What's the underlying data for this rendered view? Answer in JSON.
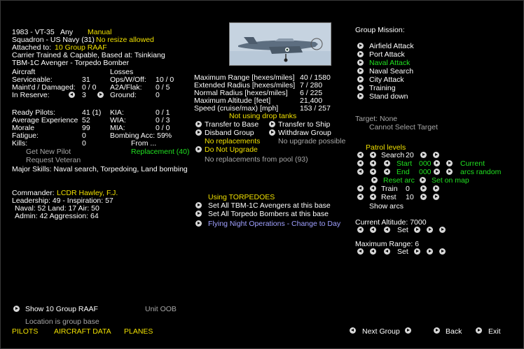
{
  "unit": {
    "line1_left": "1983 - VT-35",
    "line1_any": "Any",
    "line1_manual": "Manual",
    "squadron": "Squadron - US Navy (31)",
    "no_resize": "No resize allowed",
    "attached_label": "Attached to:",
    "attached_group": "10 Group RAAF",
    "carrier_info": "Carrier Trained & Capable, Based at:  Tsinkiang",
    "aircraft_type": "TBM-1C Avenger - Torpedo Bomber"
  },
  "aircraft_stats": {
    "header_aircraft": "Aircraft",
    "header_losses": "Losses",
    "serviceable_label": "Serviceable:",
    "serviceable_val": "31",
    "maint_label": "Maint'd / Damaged:",
    "maint_val": "0 / 0",
    "reserve_label": "In Reserve:",
    "reserve_val": "3",
    "opsoff_label": "Ops/W/Off:",
    "opsoff_val": "10 / 0",
    "a2a_label": "A2A/Flak:",
    "a2a_val": "0 / 5",
    "ground_label": "Ground:",
    "ground_val": "0"
  },
  "pilots": {
    "ready_label": "Ready Pilots:",
    "ready_val": "41 (1)",
    "exp_label": "Average Experience",
    "exp_val": "52",
    "morale_label": "Morale",
    "morale_val": "99",
    "fatigue_label": "Fatigue:",
    "fatigue_val": "0",
    "kills_label": "Kills:",
    "kills_val": "0",
    "kia_label": "KIA:",
    "kia_val": "0 / 1",
    "wia_label": "WIA:",
    "wia_val": "0 / 3",
    "mia_label": "MIA:",
    "mia_val": "0 / 0",
    "bombing_label": "Bombing Acc: 59%",
    "from_label": "From ...",
    "get_new_pilot": "Get New Pilot",
    "replacement": "Replacement (40)",
    "request_veteran": "Request Veteran",
    "major_skills": "Major Skills: Naval search, Torpedoing, Land bombing"
  },
  "commander": {
    "label": "Commander:",
    "name": "LCDR Hawley, F.J.",
    "line1": "Leadership: 49 - Inspiration: 57",
    "line2": "Naval: 52  Land: 17  Air: 50",
    "line3": "Admin: 42  Aggression: 64"
  },
  "performance": {
    "labels": [
      "Maximum Range [hexes/miles]",
      "Extended Radius [hexes/miles]",
      "Normal Radius [hexes/miles]",
      "Maximum Altitude [feet]",
      "Speed (cruise/max) [mph]"
    ],
    "values": [
      "40 / 1580",
      "7 / 280",
      "6 / 225",
      "21,400",
      "153 / 257"
    ],
    "drop_tanks": "Not using drop tanks"
  },
  "actions": {
    "transfer_base": "Transfer to Base",
    "transfer_ship": "Transfer to Ship",
    "disband": "Disband Group",
    "withdraw": "Withdraw Group",
    "no_replacements": "No replacements",
    "no_upgrade_possible": "No upgrade possible",
    "do_not_upgrade": "Do Not Upgrade",
    "no_repl_pool": "No replacements from pool (93)"
  },
  "weapons": {
    "using": "Using TORPEDOES",
    "set_all_avengers": "Set All TBM-1C Avengers at this base",
    "set_all_torpedo": "Set All Torpedo Bombers at this base",
    "night_ops": "Flying Night Operations - Change to Day"
  },
  "mission": {
    "header": "Group Mission:",
    "options": [
      "Airfield Attack",
      "Port Attack",
      "Naval Attack",
      "Naval Search",
      "City Attack",
      "Training",
      "Stand down"
    ],
    "selected_index": 2,
    "target": "Target: None",
    "cannot_select": "Cannot Select Target"
  },
  "patrol": {
    "header": "Patrol levels",
    "search_label": "Search",
    "search_val": "20",
    "start_label": "Start",
    "start_val": "000",
    "current": "Current",
    "end_label": "End",
    "end_val": "000",
    "arcs_random": "arcs random",
    "reset_arc": "Reset arc",
    "set_on_map": "Set on map",
    "train_label": "Train",
    "train_val": "0",
    "rest_label": "Rest",
    "rest_val": "10",
    "show_arcs": "Show arcs"
  },
  "altitude": {
    "label": "Current Altitude: 7000",
    "set": "Set"
  },
  "range": {
    "label": "Maximum Range: 6",
    "set": "Set"
  },
  "bottom": {
    "show_group": "Show 10 Group RAAF",
    "unit_oob": "Unit OOB",
    "location": "Location is group base",
    "tab_pilots": "PILOTS",
    "tab_aircraft": "AIRCRAFT DATA",
    "tab_planes": "PLANES",
    "next_group": "Next Group",
    "back": "Back",
    "exit": "Exit"
  },
  "colors": {
    "highlight_yellow": "#f0e000",
    "highlight_green": "#20e020",
    "disabled_gray": "#a8a8a8",
    "night_blue": "#a0a0ff"
  }
}
